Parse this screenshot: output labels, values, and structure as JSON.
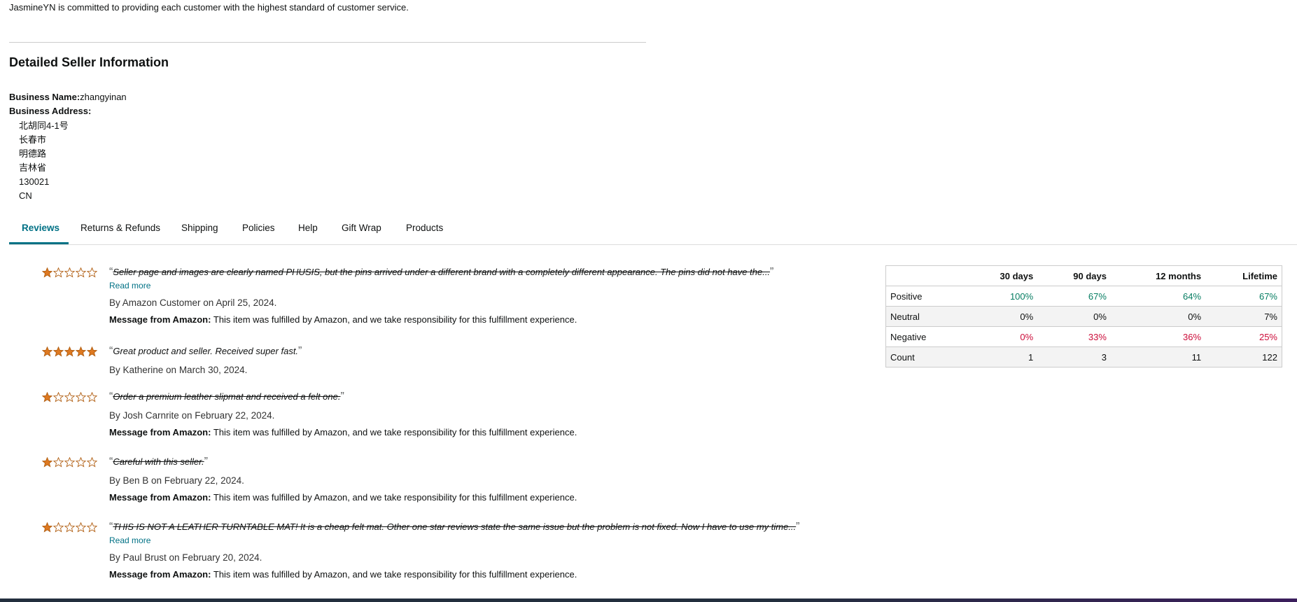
{
  "intro_text": "JasmineYN is committed to providing each customer with the highest standard of customer service.",
  "section_title": "Detailed Seller Information",
  "business": {
    "name_label": "Business Name:",
    "name_value": "zhangyinan",
    "address_label": "Business Address:",
    "address_lines": [
      "北胡同4-1号",
      "长春市",
      "明德路",
      "吉林省",
      "130021",
      "CN"
    ]
  },
  "tabs": [
    "Reviews",
    "Returns & Refunds",
    "Shipping",
    "Policies",
    "Help",
    "Gift Wrap",
    "Products"
  ],
  "active_tab": "Reviews",
  "reviews": [
    {
      "rating": 1,
      "text": "Seller page and images are clearly named PHUSIS, but the pins arrived under a different brand with a completely different appearance. The pins did not have the...",
      "struck": true,
      "read_more": "Read more",
      "byline": "By Amazon Customer on April 25, 2024.",
      "msg_label": "Message from Amazon:",
      "msg_text": " This item was fulfilled by Amazon, and we take responsibility for this fulfillment experience."
    },
    {
      "rating": 5,
      "text": "Great product and seller. Received super fast.",
      "struck": false,
      "read_more": "",
      "byline": "By Katherine on March 30, 2024.",
      "msg_label": "",
      "msg_text": ""
    },
    {
      "rating": 1,
      "text": "Order a premium leather slipmat and received a felt one.",
      "struck": true,
      "read_more": "",
      "byline": "By Josh Carnrite on February 22, 2024.",
      "msg_label": "Message from Amazon:",
      "msg_text": " This item was fulfilled by Amazon, and we take responsibility for this fulfillment experience."
    },
    {
      "rating": 1,
      "text": "Careful with this seller.",
      "struck": true,
      "read_more": "",
      "byline": "By Ben B on February 22, 2024.",
      "msg_label": "Message from Amazon:",
      "msg_text": " This item was fulfilled by Amazon, and we take responsibility for this fulfillment experience."
    },
    {
      "rating": 1,
      "text": "THIS IS NOT A LEATHER TURNTABLE MAT! It is a cheap felt mat. Other one star reviews state the same issue but the problem is not fixed. Now I have to use my time...",
      "struck": true,
      "read_more": "Read more",
      "byline": "By Paul Brust on February 20, 2024.",
      "msg_label": "Message from Amazon:",
      "msg_text": " This item was fulfilled by Amazon, and we take responsibility for this fulfillment experience."
    }
  ],
  "feedback_table": {
    "headers": [
      "",
      "30 days",
      "90 days",
      "12 months",
      "Lifetime"
    ],
    "rows": [
      {
        "label": "Positive",
        "values": [
          "100%",
          "67%",
          "64%",
          "67%"
        ],
        "color": "green"
      },
      {
        "label": "Neutral",
        "values": [
          "0%",
          "0%",
          "0%",
          "7%"
        ],
        "color": ""
      },
      {
        "label": "Negative",
        "values": [
          "0%",
          "33%",
          "36%",
          "25%"
        ],
        "color": "red"
      },
      {
        "label": "Count",
        "values": [
          "1",
          "3",
          "11",
          "122"
        ],
        "color": ""
      }
    ]
  },
  "colors": {
    "accent": "#007185",
    "star": "#de7921",
    "positive": "#067d62",
    "negative": "#cc0c39"
  },
  "icons": {
    "star_full": "star-full-icon",
    "star_empty": "star-empty-icon"
  }
}
